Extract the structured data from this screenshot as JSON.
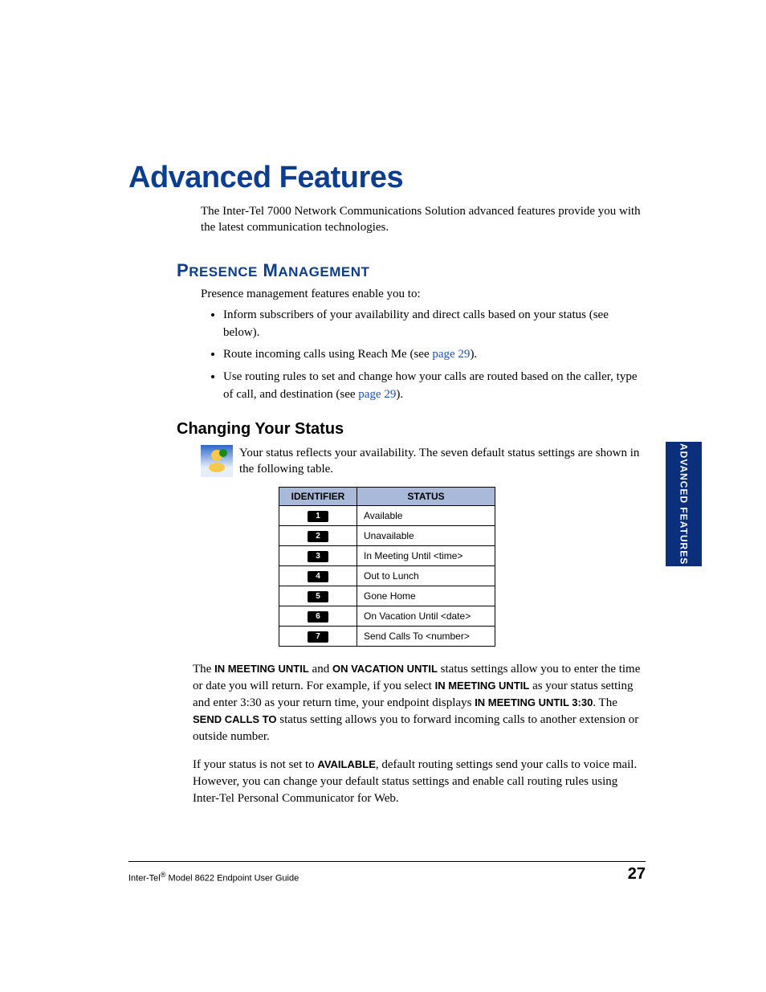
{
  "title": "Advanced Features",
  "intro": "The Inter-Tel 7000 Network Communications Solution advanced features provide you with the latest communication technologies.",
  "presence": {
    "heading": "Presence Management",
    "intro": "Presence management features enable you to:",
    "bullets": {
      "b1a": "Inform subscribers of your availability and direct calls based on your status (see below).",
      "b2a": "Route incoming calls using Reach Me (see ",
      "b2link": "page 29",
      "b2b": ").",
      "b3a": "Use routing rules to set and change how your calls are routed based on the caller, type of call, and destination (see ",
      "b3link": "page 29",
      "b3b": ")."
    }
  },
  "changing": {
    "heading": "Changing Your Status",
    "intro": "Your status reflects your availability. The seven default status settings are shown in the following table.",
    "table": {
      "col1": "IDENTIFIER",
      "col2": "STATUS",
      "rows": [
        {
          "id": "1",
          "status": "Available"
        },
        {
          "id": "2",
          "status": "Unavailable"
        },
        {
          "id": "3",
          "status": "In Meeting Until <time>"
        },
        {
          "id": "4",
          "status": "Out to Lunch"
        },
        {
          "id": "5",
          "status": "Gone Home"
        },
        {
          "id": "6",
          "status": "On Vacation Until <date>"
        },
        {
          "id": "7",
          "status": "Send Calls To <number>"
        }
      ]
    },
    "para1": {
      "p1": "The ",
      "b1": "IN MEETING UNTIL",
      "p2": " and ",
      "b2": "ON VACATION UNTIL",
      "p3": " status settings allow you to enter the time or date you will return. For example, if you select ",
      "b3": "IN MEETING UNTIL",
      "p4": " as your status setting and enter 3:30 as your return time, your endpoint displays ",
      "b4": "IN MEETING UNTIL 3:30",
      "p5": ". The ",
      "b5": "SEND CALLS TO",
      "p6": " status setting allows you to forward incoming calls to another extension or outside number."
    },
    "para2": {
      "p1": "If your status is not set to ",
      "b1": "AVAILABLE",
      "p2": ", default routing settings send your calls to voice mail. However, you can change your default status settings and enable call routing rules using Inter-Tel Personal Communicator for Web."
    }
  },
  "sideTab": "ADVANCED FEATURES",
  "footer": {
    "left_pre": "Inter-Tel",
    "left_sup": "®",
    "left_post": " Model 8622 Endpoint User Guide",
    "page": "27"
  }
}
